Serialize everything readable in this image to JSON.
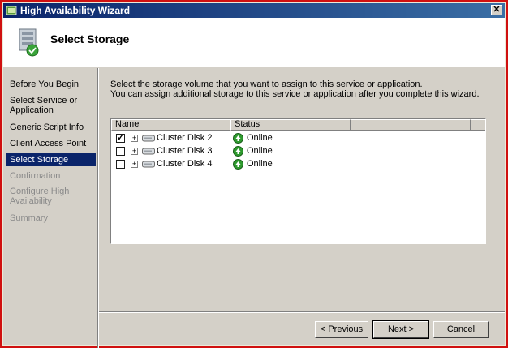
{
  "window": {
    "title": "High Availability Wizard"
  },
  "header": {
    "title": "Select Storage",
    "icon": "storage-wizard-icon"
  },
  "nav": {
    "items": [
      {
        "label": "Before You Begin",
        "state": "normal"
      },
      {
        "label": "Select Service or Application",
        "state": "normal"
      },
      {
        "label": "Generic Script Info",
        "state": "normal"
      },
      {
        "label": "Client Access Point",
        "state": "normal"
      },
      {
        "label": "Select Storage",
        "state": "selected"
      },
      {
        "label": "Confirmation",
        "state": "disabled"
      },
      {
        "label": "Configure High Availability",
        "state": "disabled"
      },
      {
        "label": "Summary",
        "state": "disabled"
      }
    ]
  },
  "main": {
    "description_line1": "Select the storage volume that you want to assign to this service or application.",
    "description_line2": "You can assign additional storage to this service or application after you complete this wizard.",
    "table": {
      "columns": [
        "Name",
        "Status"
      ],
      "rows": [
        {
          "checked": true,
          "name": "Cluster Disk 2",
          "status": "Online"
        },
        {
          "checked": false,
          "name": "Cluster Disk 3",
          "status": "Online"
        },
        {
          "checked": false,
          "name": "Cluster Disk 4",
          "status": "Online"
        }
      ]
    }
  },
  "buttons": {
    "previous": "< Previous",
    "next": "Next >",
    "cancel": "Cancel"
  },
  "colors": {
    "selected_nav_bg": "#0a246a",
    "window_border": "#d01010",
    "status_green": "#2e9a2e"
  }
}
